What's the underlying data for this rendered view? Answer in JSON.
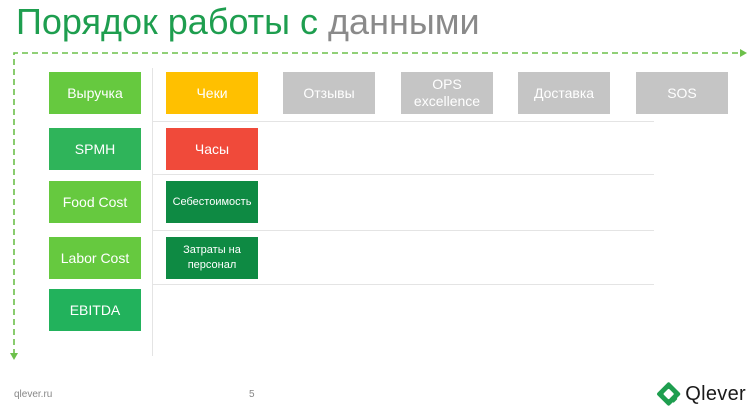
{
  "title": {
    "part1": "Порядок работы с ",
    "part2": "данными"
  },
  "metrics": [
    "Выручка",
    "SPMH",
    "Food Cost",
    "Labor Cost",
    "EBITDA"
  ],
  "sources_row1": [
    "Чеки",
    "Отзывы",
    "OPS excellence",
    "Доставка",
    "SOS"
  ],
  "sources_col": [
    "Часы",
    "Себестоимость",
    "Затраты на персонал"
  ],
  "footer": {
    "url": "qlever.ru",
    "page": "5"
  },
  "logo": {
    "text": "Qlever",
    "icon": "qlever-logo-icon"
  },
  "colors": {
    "green_light": "#66c93f",
    "green_mid": "#2fb45a",
    "green_dark": "#0e8a43",
    "green_ebitda": "#22b25c",
    "yellow": "#ffc000",
    "red": "#f04a3a",
    "gray": "#c5c5c5",
    "dash": "#6cc04a"
  }
}
